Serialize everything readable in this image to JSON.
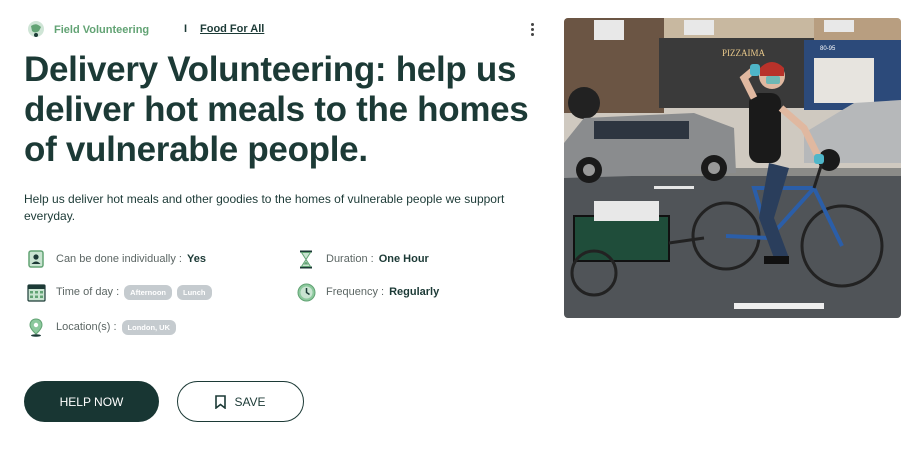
{
  "header": {
    "category_label": "Field Volunteering",
    "separator": "I",
    "org_link": "Food For All",
    "category_icon": "field-volunteering-icon",
    "more_icon": "kebab-menu-icon"
  },
  "title": "Delivery Volunteering: help us deliver hot meals to the homes of vulnerable people.",
  "description": "Help us deliver hot meals and other goodies to the homes of vulnerable people we support everyday.",
  "attributes": {
    "individual": {
      "label": "Can be done individually :",
      "value": "Yes",
      "icon": "person-badge-icon"
    },
    "time_of_day": {
      "label": "Time of day :",
      "chips": [
        "Afternoon",
        "Lunch"
      ],
      "icon": "calendar-icon"
    },
    "location": {
      "label": "Location(s) :",
      "chips": [
        "London, UK"
      ],
      "icon": "map-pin-icon"
    },
    "duration": {
      "label": "Duration :",
      "value": "One Hour",
      "icon": "hourglass-icon"
    },
    "frequency": {
      "label": "Frequency :",
      "value": "Regularly",
      "icon": "clock-icon"
    }
  },
  "buttons": {
    "help_now": "HELP NOW",
    "save": "SAVE"
  },
  "photo": {
    "shop_sign": "PIZZAIMA",
    "shop_number": "80-95"
  },
  "colors": {
    "primary": "#183633",
    "accent_green": "#62a374",
    "chip_bg": "#c5cbcf"
  }
}
